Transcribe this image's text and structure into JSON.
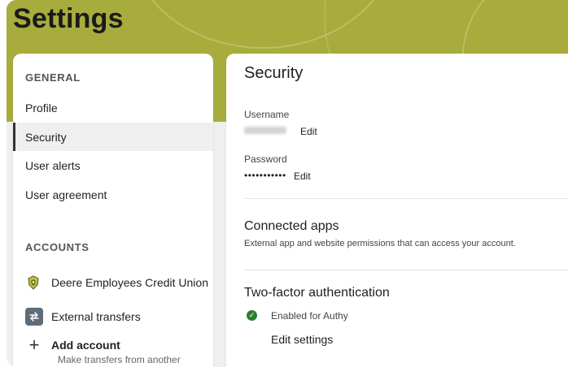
{
  "header": {
    "title": "Settings"
  },
  "sidebar": {
    "general_heading": "GENERAL",
    "general_items": [
      {
        "label": "Profile"
      },
      {
        "label": "Security"
      },
      {
        "label": "User alerts"
      },
      {
        "label": "User agreement"
      }
    ],
    "accounts_heading": "ACCOUNTS",
    "accounts": [
      {
        "label": "Deere Employees Credit Union",
        "icon": "credit-union-logo-icon"
      },
      {
        "label": "External transfers",
        "icon": "transfer-arrows-icon"
      }
    ],
    "add_account": {
      "label": "Add account",
      "sublabel": "Make transfers from another"
    },
    "active_item": "Security"
  },
  "main": {
    "title": "Security",
    "username": {
      "label": "Username",
      "edit_label": "Edit"
    },
    "password": {
      "label": "Password",
      "masked_value": "•••••••••••",
      "edit_label": "Edit"
    },
    "connected_apps": {
      "title": "Connected apps",
      "description": "External app and website permissions that can access your account."
    },
    "two_factor": {
      "title": "Two-factor authentication",
      "status": "Enabled for Authy",
      "edit_label": "Edit settings"
    }
  },
  "colors": {
    "header_band": "#a8ac3c",
    "active_nav_bg": "#efefef",
    "status_check": "#2e7d32",
    "transfer_icon_bg": "#5f6b78"
  }
}
